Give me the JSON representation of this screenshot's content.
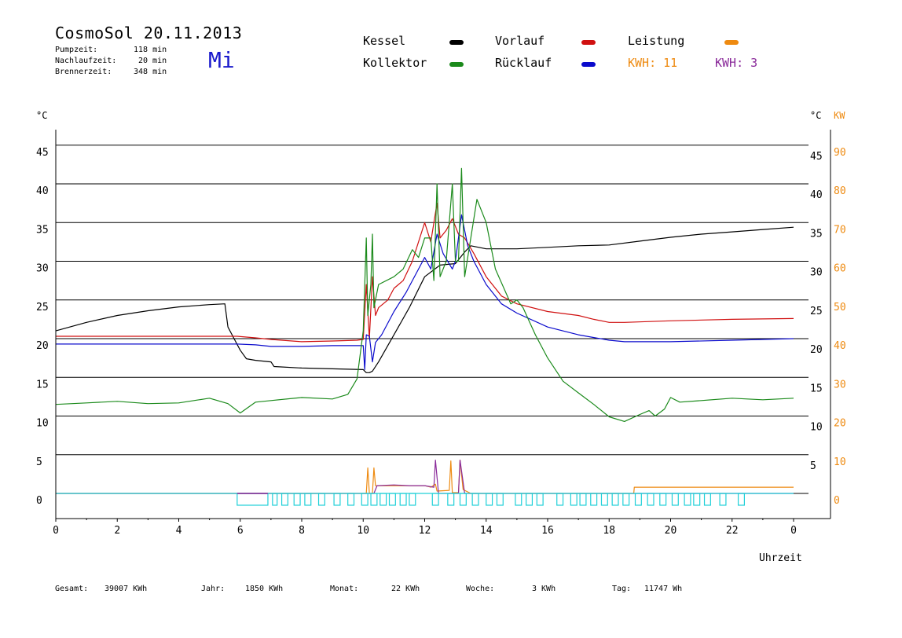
{
  "header": {
    "title": "CosmoSol 20.11.2013",
    "day": "Mi",
    "stats": [
      {
        "label": "Pumpzeit:",
        "value": "118 min"
      },
      {
        "label": "Nachlaufzeit:",
        "value": "20 min"
      },
      {
        "label": "Brennerzeit:",
        "value": "348 min"
      }
    ]
  },
  "legend": {
    "kessel": {
      "label": "Kessel",
      "color": "#000000"
    },
    "kollektor": {
      "label": "Kollektor",
      "color": "#1b8a1b"
    },
    "vorlauf": {
      "label": "Vorlauf",
      "color": "#d01010"
    },
    "ruecklauf": {
      "label": "Rücklauf",
      "color": "#0a0acc"
    },
    "leistung": {
      "label": "Leistung",
      "color": "#ee8a10"
    },
    "kwh_orange": "KWH: 11",
    "kwh_purple": "KWH: 3",
    "purple_color": "#8a2a9a",
    "cyan_color": "#20d0d8"
  },
  "footer": {
    "gesamt_label": "Gesamt:",
    "gesamt_value": "39007 KWh",
    "jahr_label": "Jahr:",
    "jahr_value": "1850 KWh",
    "monat_label": "Monat:",
    "monat_value": "22 KWh",
    "woche_label": "Woche:",
    "woche_value": "3 KWh",
    "tag_label": "Tag:",
    "tag_value": "11747 Wh"
  },
  "chart_data": {
    "type": "line",
    "xlabel": "Uhrzeit",
    "left_unit": "°C",
    "right_unit_c": "°C",
    "right_unit_kw": "KW",
    "xlim": [
      0,
      24
    ],
    "ylim": [
      -3,
      47
    ],
    "x_ticks": [
      "0",
      "2",
      "4",
      "6",
      "8",
      "10",
      "12",
      "14",
      "16",
      "18",
      "20",
      "22",
      "0"
    ],
    "left_ticks": [
      0,
      5,
      10,
      15,
      20,
      25,
      30,
      35,
      40,
      45
    ],
    "right_c_ticks": [
      5,
      10,
      15,
      20,
      25,
      30,
      35,
      40,
      45
    ],
    "right_kw_ticks": [
      0,
      10,
      20,
      30,
      40,
      50,
      60,
      70,
      80,
      90
    ],
    "gridlines": [
      0,
      5,
      10,
      15,
      20,
      25,
      30,
      35,
      40,
      45
    ],
    "series": [
      {
        "name": "Kessel",
        "color": "#000000",
        "points": [
          [
            0,
            21
          ],
          [
            1,
            22.1
          ],
          [
            2,
            23
          ],
          [
            3,
            23.6
          ],
          [
            4,
            24.1
          ],
          [
            5,
            24.4
          ],
          [
            5.5,
            24.5
          ],
          [
            5.6,
            21.5
          ],
          [
            5.8,
            20
          ],
          [
            6,
            18.5
          ],
          [
            6.2,
            17.4
          ],
          [
            6.5,
            17.2
          ],
          [
            7,
            17
          ],
          [
            7.1,
            16.4
          ],
          [
            8,
            16.2
          ],
          [
            9,
            16.1
          ],
          [
            10,
            16
          ],
          [
            10.1,
            15.6
          ],
          [
            10.2,
            15.6
          ],
          [
            10.3,
            15.8
          ],
          [
            10.5,
            17
          ],
          [
            11,
            20.5
          ],
          [
            11.5,
            24
          ],
          [
            12,
            28
          ],
          [
            12.5,
            29.5
          ],
          [
            13,
            29.7
          ],
          [
            13.3,
            31.2
          ],
          [
            13.5,
            32
          ],
          [
            14,
            31.6
          ],
          [
            15,
            31.6
          ],
          [
            16,
            31.8
          ],
          [
            17,
            32
          ],
          [
            18,
            32.1
          ],
          [
            19,
            32.6
          ],
          [
            20,
            33.1
          ],
          [
            21,
            33.5
          ],
          [
            22,
            33.8
          ],
          [
            23,
            34.1
          ],
          [
            24,
            34.4
          ]
        ]
      },
      {
        "name": "Vorlauf",
        "color": "#d01010",
        "points": [
          [
            0,
            20.3
          ],
          [
            2,
            20.3
          ],
          [
            4,
            20.3
          ],
          [
            5.9,
            20.3
          ],
          [
            6.5,
            20.1
          ],
          [
            7,
            19.9
          ],
          [
            8,
            19.6
          ],
          [
            9,
            19.7
          ],
          [
            9.8,
            19.8
          ],
          [
            10,
            19.9
          ],
          [
            10.1,
            27
          ],
          [
            10.2,
            20
          ],
          [
            10.3,
            28
          ],
          [
            10.4,
            23
          ],
          [
            10.5,
            24
          ],
          [
            10.8,
            25
          ],
          [
            11,
            26.5
          ],
          [
            11.3,
            27.5
          ],
          [
            11.6,
            30
          ],
          [
            12,
            35
          ],
          [
            12.2,
            32.5
          ],
          [
            12.4,
            37.5
          ],
          [
            12.5,
            33
          ],
          [
            12.7,
            34
          ],
          [
            12.9,
            35.5
          ],
          [
            13.1,
            33.5
          ],
          [
            13.3,
            33
          ],
          [
            13.6,
            31
          ],
          [
            14,
            28
          ],
          [
            14.5,
            25.5
          ],
          [
            15,
            24.5
          ],
          [
            16,
            23.5
          ],
          [
            17,
            23
          ],
          [
            17.5,
            22.5
          ],
          [
            18,
            22.1
          ],
          [
            18.5,
            22.1
          ],
          [
            20,
            22.3
          ],
          [
            22,
            22.5
          ],
          [
            24,
            22.6
          ]
        ]
      },
      {
        "name": "Rücklauf",
        "color": "#0a0acc",
        "points": [
          [
            0,
            19.3
          ],
          [
            2,
            19.3
          ],
          [
            4,
            19.3
          ],
          [
            5.9,
            19.3
          ],
          [
            6.5,
            19.2
          ],
          [
            7,
            19
          ],
          [
            8,
            19
          ],
          [
            9,
            19.1
          ],
          [
            10,
            19.1
          ],
          [
            10.05,
            16
          ],
          [
            10.1,
            20.5
          ],
          [
            10.2,
            20.3
          ],
          [
            10.3,
            17
          ],
          [
            10.4,
            19.5
          ],
          [
            10.6,
            20.5
          ],
          [
            11,
            23.5
          ],
          [
            11.4,
            26
          ],
          [
            11.8,
            29
          ],
          [
            12,
            30.5
          ],
          [
            12.2,
            29
          ],
          [
            12.4,
            33.5
          ],
          [
            12.6,
            31
          ],
          [
            12.9,
            29
          ],
          [
            13,
            30
          ],
          [
            13.2,
            36
          ],
          [
            13.4,
            32
          ],
          [
            13.6,
            30
          ],
          [
            14,
            27
          ],
          [
            14.5,
            24.5
          ],
          [
            15,
            23.3
          ],
          [
            16,
            21.5
          ],
          [
            17,
            20.5
          ],
          [
            18,
            19.8
          ],
          [
            18.5,
            19.6
          ],
          [
            20,
            19.6
          ],
          [
            22,
            19.8
          ],
          [
            24,
            20
          ]
        ]
      },
      {
        "name": "Kollektor",
        "color": "#1b8a1b",
        "points": [
          [
            0,
            11.5
          ],
          [
            1,
            11.7
          ],
          [
            2,
            11.9
          ],
          [
            3,
            11.6
          ],
          [
            4,
            11.7
          ],
          [
            5,
            12.3
          ],
          [
            5.6,
            11.6
          ],
          [
            6,
            10.4
          ],
          [
            6.5,
            11.8
          ],
          [
            7,
            12
          ],
          [
            8,
            12.4
          ],
          [
            9,
            12.2
          ],
          [
            9.5,
            12.8
          ],
          [
            9.8,
            14.8
          ],
          [
            10,
            21
          ],
          [
            10.1,
            33
          ],
          [
            10.15,
            23
          ],
          [
            10.25,
            27
          ],
          [
            10.3,
            33.5
          ],
          [
            10.35,
            24
          ],
          [
            10.5,
            27
          ],
          [
            11,
            28
          ],
          [
            11.3,
            29
          ],
          [
            11.6,
            31.5
          ],
          [
            11.8,
            30.5
          ],
          [
            12,
            33
          ],
          [
            12.2,
            33
          ],
          [
            12.3,
            27.5
          ],
          [
            12.4,
            40
          ],
          [
            12.5,
            28
          ],
          [
            12.7,
            30
          ],
          [
            12.9,
            40
          ],
          [
            13,
            30
          ],
          [
            13.1,
            30
          ],
          [
            13.2,
            42
          ],
          [
            13.3,
            28
          ],
          [
            13.5,
            33
          ],
          [
            13.7,
            38
          ],
          [
            14,
            35
          ],
          [
            14.3,
            29
          ],
          [
            14.8,
            24.5
          ],
          [
            15,
            25
          ],
          [
            15.2,
            24
          ],
          [
            15.6,
            20.5
          ],
          [
            16,
            17.5
          ],
          [
            16.5,
            14.5
          ],
          [
            17,
            13
          ],
          [
            17.5,
            11.5
          ],
          [
            18,
            9.9
          ],
          [
            18.5,
            9.3
          ],
          [
            19,
            10.2
          ],
          [
            19.3,
            10.7
          ],
          [
            19.5,
            10
          ],
          [
            19.8,
            10.9
          ],
          [
            20,
            12.4
          ],
          [
            20.3,
            11.8
          ],
          [
            21,
            12
          ],
          [
            22,
            12.3
          ],
          [
            23,
            12.1
          ],
          [
            24,
            12.3
          ]
        ]
      },
      {
        "name": "Leistung",
        "color": "#ee8a10",
        "points": [
          [
            0,
            0
          ],
          [
            10.1,
            0
          ],
          [
            10.15,
            3.3
          ],
          [
            10.2,
            0
          ],
          [
            10.3,
            0
          ],
          [
            10.35,
            3.3
          ],
          [
            10.4,
            1
          ],
          [
            11,
            1
          ],
          [
            12,
            1
          ],
          [
            12.2,
            0.8
          ],
          [
            12.35,
            1.2
          ],
          [
            12.4,
            0.3
          ],
          [
            12.8,
            0.4
          ],
          [
            12.85,
            4.2
          ],
          [
            12.9,
            0.1
          ],
          [
            13.1,
            0.1
          ],
          [
            13.15,
            4.3
          ],
          [
            13.25,
            0.5
          ],
          [
            13.5,
            0
          ],
          [
            18.8,
            0
          ],
          [
            18.82,
            0.8
          ],
          [
            24,
            0.8
          ]
        ]
      },
      {
        "name": "",
        "color": "#8a2a9a",
        "points": [
          [
            0,
            0
          ],
          [
            10.35,
            0
          ],
          [
            10.45,
            1
          ],
          [
            11,
            1.1
          ],
          [
            11.5,
            1
          ],
          [
            12,
            1
          ],
          [
            12.3,
            0.8
          ],
          [
            12.35,
            4.3
          ],
          [
            12.45,
            0
          ],
          [
            13.1,
            0
          ],
          [
            13.15,
            4.3
          ],
          [
            13.3,
            0
          ],
          [
            24,
            0
          ]
        ]
      }
    ],
    "pump_pulses": [
      [
        5.9,
        6.9
      ],
      [
        7.05,
        7.2
      ],
      [
        7.35,
        7.55
      ],
      [
        7.75,
        7.95
      ],
      [
        8.1,
        8.3
      ],
      [
        8.55,
        8.75
      ],
      [
        9.05,
        9.25
      ],
      [
        9.5,
        9.7
      ],
      [
        9.95,
        10.15
      ],
      [
        10.25,
        10.45
      ],
      [
        10.55,
        10.75
      ],
      [
        10.85,
        11.05
      ],
      [
        11.2,
        11.4
      ],
      [
        11.5,
        11.7
      ],
      [
        12.25,
        12.45
      ],
      [
        12.75,
        12.95
      ],
      [
        13.15,
        13.35
      ],
      [
        13.55,
        13.75
      ],
      [
        14,
        14.2
      ],
      [
        14.35,
        14.55
      ],
      [
        14.95,
        15.15
      ],
      [
        15.3,
        15.5
      ],
      [
        15.65,
        15.85
      ],
      [
        16.3,
        16.5
      ],
      [
        16.75,
        16.95
      ],
      [
        17.05,
        17.25
      ],
      [
        17.4,
        17.6
      ],
      [
        17.75,
        17.95
      ],
      [
        18.1,
        18.3
      ],
      [
        18.45,
        18.65
      ],
      [
        18.85,
        19.05
      ],
      [
        19.25,
        19.45
      ],
      [
        19.65,
        19.85
      ],
      [
        20.05,
        20.25
      ],
      [
        20.45,
        20.65
      ],
      [
        20.75,
        20.95
      ],
      [
        21.1,
        21.3
      ],
      [
        21.6,
        21.8
      ],
      [
        22.2,
        22.4
      ]
    ]
  }
}
